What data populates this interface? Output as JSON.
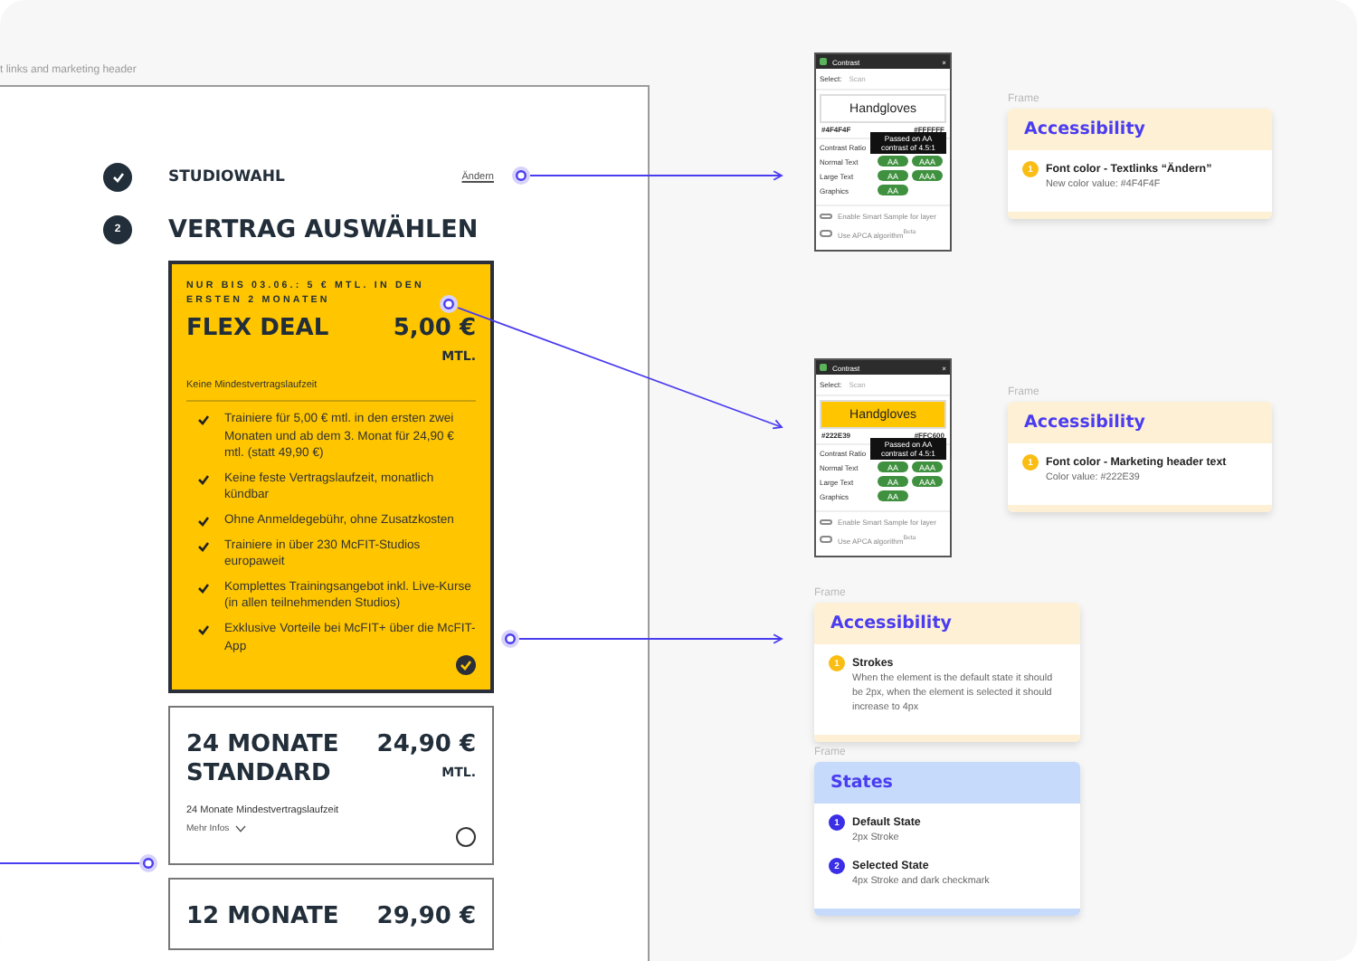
{
  "canvas_label": "t links and marketing header",
  "steps": [
    {
      "kind": "done",
      "title": "STUDIOWAHL",
      "link": "Ändern"
    },
    {
      "kind": "number",
      "number": "2",
      "title": "VERTRAG AUSWÄHLEN"
    }
  ],
  "offers": [
    {
      "kind": "deal",
      "promo": "NUR BIS 03.06.: 5 € MTL. IN DEN ERSTEN 2 MONATEN",
      "name": "FLEX DEAL",
      "price": "5,00 €",
      "period": "MTL.",
      "term": "Keine Mindestvertragslaufzeit",
      "features": [
        "Trainiere für 5,00 € mtl. in den ersten zwei Monaten und ab dem 3. Monat für 24,90 € mtl. (statt 49,90 €)",
        "Keine feste Vertragslaufzeit, monatlich kündbar",
        "Ohne Anmeldegebühr, ohne Zusatzkosten",
        "Trainiere in über 230 McFIT-Studios europaweit",
        "Komplettes Trainingsangebot inkl. Live-Kurse (in allen teilnehmenden Studios)",
        "Exklusive Vorteile bei McFIT+ über die McFIT-App"
      ],
      "selected": true
    },
    {
      "kind": "standard",
      "name": "24 MONATE STANDARD",
      "price": "24,90 €",
      "period": "MTL.",
      "term": "24 Monate Mindestvertragslaufzeit",
      "more": "Mehr Infos",
      "selected": false
    },
    {
      "kind": "standard",
      "name": "12 MONATE",
      "price": "29,90 €",
      "selected": false
    }
  ],
  "contrast_panels": [
    {
      "title": "Contrast",
      "close": "×",
      "select_label": "Select:",
      "select_value": "Scan",
      "sample": "Handgloves",
      "foreground": "#4F4F4F",
      "background": "#FFFFFF",
      "tooltip": "Passed on AA contrast of 4.5:1",
      "rows": [
        {
          "label": "Contrast Ratio",
          "badges": []
        },
        {
          "label": "Normal Text",
          "badges": [
            "AA",
            "AAA"
          ]
        },
        {
          "label": "Large Text",
          "badges": [
            "AA",
            "AAA"
          ]
        },
        {
          "label": "Graphics",
          "badges": [
            "AA"
          ]
        }
      ],
      "options": [
        {
          "label": "Enable Smart Sample for layer",
          "on": false
        },
        {
          "label": "Use APCA algorithm",
          "sup": "Beta",
          "on": false
        }
      ]
    },
    {
      "title": "Contrast",
      "close": "×",
      "select_label": "Select:",
      "select_value": "Scan",
      "sample": "Handgloves",
      "foreground": "#222E39",
      "background": "#FFC600",
      "tooltip": "Passed on AA contrast of 4.5:1",
      "rows": [
        {
          "label": "Contrast Ratio",
          "badges": []
        },
        {
          "label": "Normal Text",
          "badges": [
            "AA",
            "AAA"
          ]
        },
        {
          "label": "Large Text",
          "badges": [
            "AA",
            "AAA"
          ]
        },
        {
          "label": "Graphics",
          "badges": [
            "AA"
          ]
        }
      ],
      "options": [
        {
          "label": "Enable Smart Sample for layer",
          "on": false
        },
        {
          "label": "Use APCA algorithm",
          "sup": "Beta",
          "on": false
        }
      ]
    }
  ],
  "annotations": [
    {
      "frame_label": "Frame",
      "kind": "accessibility",
      "title": "Accessibility",
      "items": [
        {
          "number": "1",
          "title": "Font color - Textlinks “Ändern”",
          "text": "New color value: #4F4F4F"
        }
      ]
    },
    {
      "frame_label": "Frame",
      "kind": "accessibility",
      "title": "Accessibility",
      "items": [
        {
          "number": "1",
          "title": "Font color - Marketing header text",
          "text": "Color value: #222E39"
        }
      ]
    },
    {
      "frame_label": "Frame",
      "kind": "accessibility",
      "title": "Accessibility",
      "items": [
        {
          "number": "1",
          "title": "Strokes",
          "text": "When  the element is the default state it should be 2px, when the element is selected it should increase to 4px"
        }
      ]
    },
    {
      "frame_label": "Frame",
      "kind": "states",
      "title": "States",
      "items": [
        {
          "number": "1",
          "title": "Default State",
          "text": "2px Stroke"
        },
        {
          "number": "2",
          "title": "Selected State",
          "text": "4px Stroke and dark checkmark"
        }
      ]
    }
  ]
}
